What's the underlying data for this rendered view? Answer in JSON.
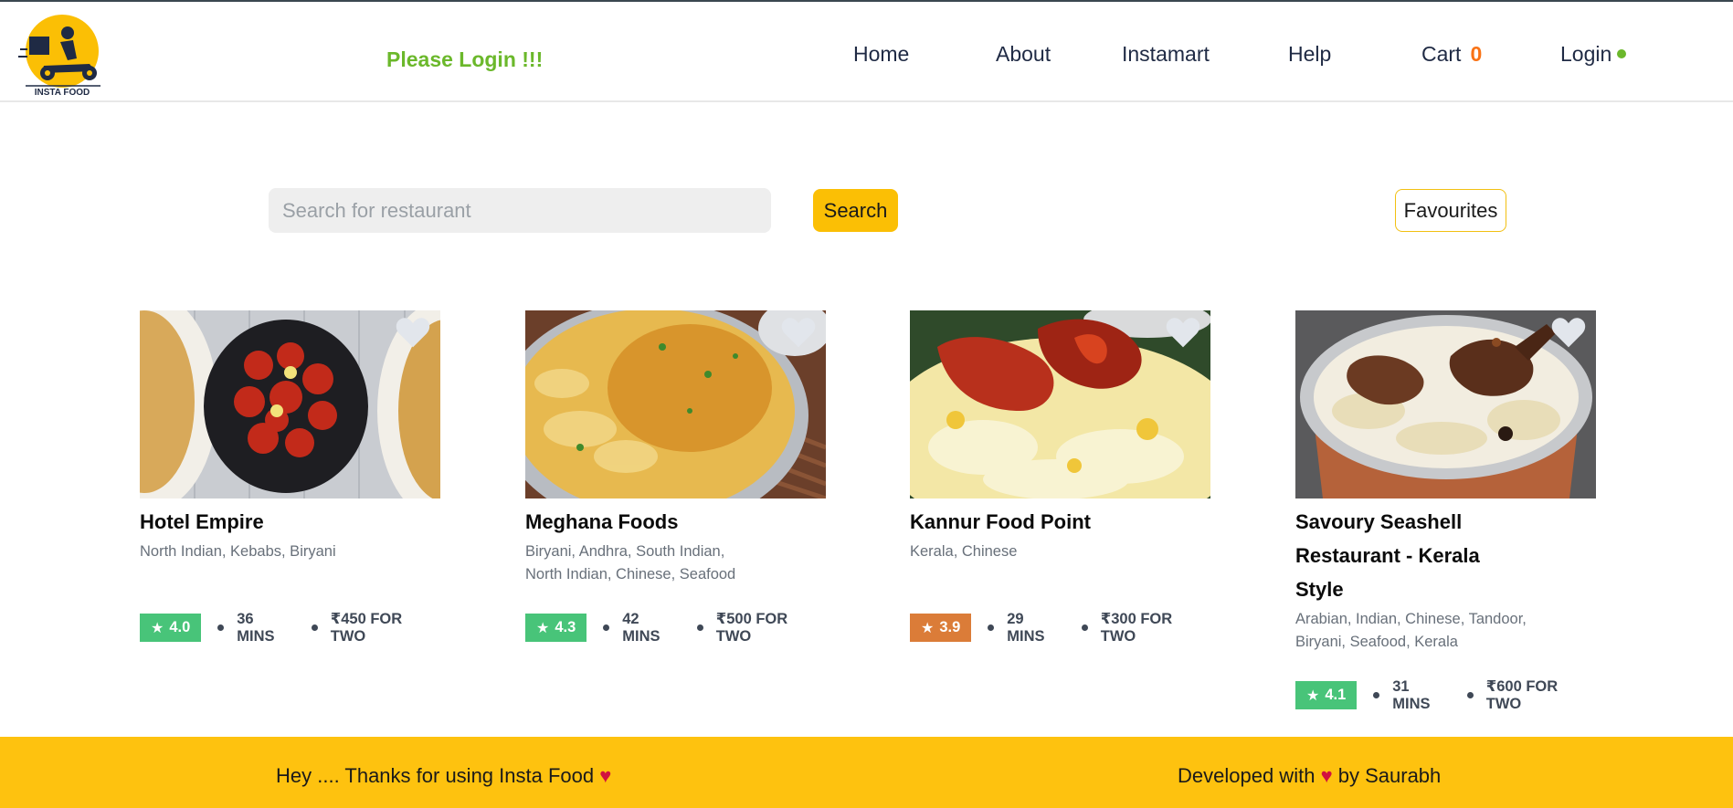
{
  "header": {
    "logo_text": "INSTA FOOD",
    "login_message": "Please Login !!!",
    "nav": {
      "home": "Home",
      "about": "About",
      "instamart": "Instamart",
      "help": "Help",
      "cart_label": "Cart",
      "cart_count": "0",
      "login": "Login"
    }
  },
  "search": {
    "placeholder": "Search for restaurant",
    "button_label": "Search",
    "favourites_label": "Favourites"
  },
  "restaurants": [
    {
      "name": "Hotel Empire",
      "cuisines": "North Indian, Kebabs, Biryani",
      "rating": "4.0",
      "rating_color": "#48c479",
      "time": "36 MINS",
      "cost": "₹450 FOR TWO"
    },
    {
      "name": "Meghana Foods",
      "cuisines": "Biryani, Andhra, South Indian, North Indian, Chinese, Seafood",
      "rating": "4.3",
      "rating_color": "#48c479",
      "time": "42 MINS",
      "cost": "₹500 FOR TWO"
    },
    {
      "name": "Kannur Food Point",
      "cuisines": "Kerala, Chinese",
      "rating": "3.9",
      "rating_color": "#db7c38",
      "time": "29 MINS",
      "cost": "₹300 FOR TWO"
    },
    {
      "name": "Savoury Seashell Restaurant - Kerala Style",
      "cuisines": "Arabian, Indian, Chinese, Tandoor, Biryani, Seafood, Kerala",
      "rating": "4.1",
      "rating_color": "#48c479",
      "time": "31 MINS",
      "cost": "₹600 FOR TWO"
    }
  ],
  "footer": {
    "left_text": "Hey .... Thanks for using Insta Food",
    "right_prefix": "Developed with",
    "right_suffix": "by Saurabh"
  },
  "colors": {
    "brand_yellow": "#fec20f",
    "login_green": "#6bb82b",
    "cart_orange": "#f97316",
    "heart_red": "#d1123f"
  }
}
